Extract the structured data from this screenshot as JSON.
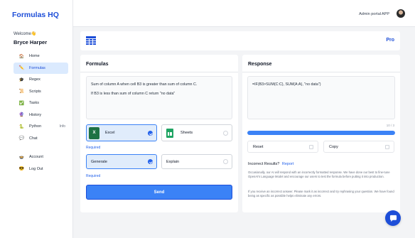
{
  "sidebar": {
    "logo": "Formulas HQ",
    "welcome": "Welcome👋",
    "user_name": "Bryce Harper",
    "items": [
      {
        "label": "Home",
        "icon": "🏠"
      },
      {
        "label": "Formulas",
        "icon": "✏️"
      },
      {
        "label": "Regex",
        "icon": "🎓"
      },
      {
        "label": "Scripts",
        "icon": "📜"
      },
      {
        "label": "Tasks",
        "icon": "✅"
      },
      {
        "label": "History",
        "icon": "🔮"
      },
      {
        "label": "Python",
        "icon": "🐍",
        "badge": "Info"
      },
      {
        "label": "Chat",
        "icon": "💬"
      }
    ],
    "bottom_items": [
      {
        "label": "Account",
        "icon": "🍲"
      },
      {
        "label": "Log Out",
        "icon": "😎"
      }
    ]
  },
  "topbar": {
    "admin_portal": "Admin portal",
    "app": "APP"
  },
  "banner": {
    "pro": "Pro"
  },
  "formulas": {
    "title": "Formulas",
    "text_line1": "Sum of column A when cell B3 is greater than sum of column C.",
    "text_line2": "If B3 is less than sum of column C return \"no data\"",
    "excel_label": "Excel",
    "sheets_label": "Sheets",
    "required1": "Required",
    "generate_label": "Generate",
    "explain_label": "Explain",
    "required2": "Required",
    "send_label": "Send"
  },
  "response": {
    "title": "Response",
    "text": "=IF(B3>SUM(C:C), SUM(A:A), \"no data\")",
    "counter": "10 / 3",
    "progress": 1.0,
    "reset_label": "Reset",
    "copy_label": "Copy",
    "incorrect_label": "Incorrect Results?",
    "report_label": "Report",
    "info1": "Occasionally, our AI will respond with an incorrectly formatted response. We have done our best to fine-tune OpenAI's Language Model and encourage our users to test the formula before putting it into production.",
    "info2": "If you receive an incorrect answer. Please mark it as incorrect and try rephrasing your question. We have found being as specific as possible helps eliminate any errors."
  },
  "colors": {
    "accent": "#3b82f6",
    "brand": "#1d4ed8",
    "excel": "#1f7244",
    "sheets": "#1fa463"
  }
}
